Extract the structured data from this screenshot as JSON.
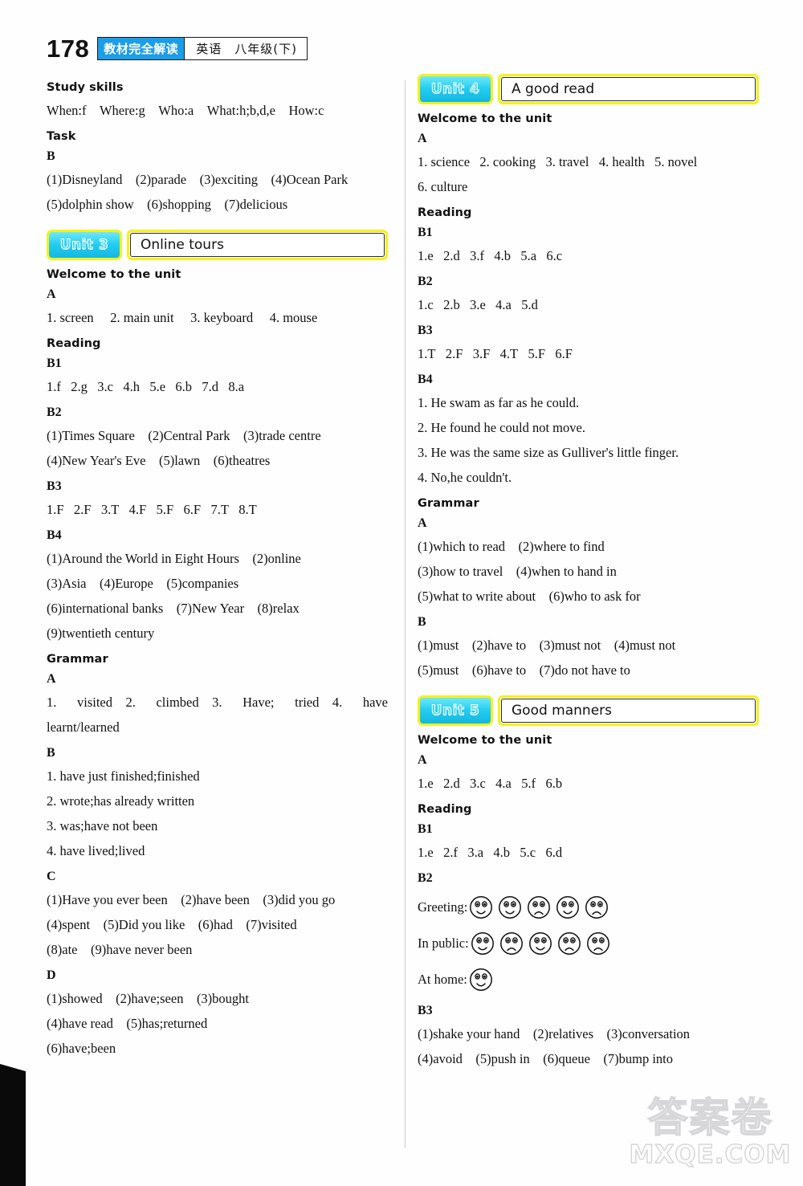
{
  "header": {
    "page_number": "178",
    "series_tag": "教材完全解读",
    "subject": "英语　八年级(下)"
  },
  "left_column": {
    "study_skills": {
      "heading": "Study skills",
      "answers": "When:f Where:g Who:a What:h;b,d,e How:c"
    },
    "task": {
      "heading": "Task",
      "sub": "B",
      "lines": [
        "(1)Disneyland (2)parade (3)exciting (4)Ocean Park",
        "(5)dolphin show (6)shopping (7)delicious"
      ]
    },
    "unit3": {
      "badge": "Unit 3",
      "title": "Online tours",
      "welcome_heading": "Welcome to the unit",
      "welcome_sub": "A",
      "welcome_answers": "1. screen  2. main unit  3. keyboard  4. mouse",
      "reading_heading": "Reading",
      "b1_label": "B1",
      "b1_answers": "1.f  2.g  3.c  4.h  5.e  6.b  7.d  8.a",
      "b2_label": "B2",
      "b2_lines": [
        "(1)Times Square (2)Central Park (3)trade centre",
        "(4)New Year's Eve (5)lawn (6)theatres"
      ],
      "b3_label": "B3",
      "b3_answers": "1.F  2.F  3.T  4.F  5.F  6.F  7.T  8.T",
      "b4_label": "B4",
      "b4_lines": [
        "(1)Around the World in Eight Hours (2)online",
        "(3)Asia (4)Europe (5)companies",
        "(6)international banks (7)New Year (8)relax",
        "(9)twentieth century"
      ],
      "grammar_heading": "Grammar",
      "grammar_a_label": "A",
      "grammar_a_line1": "1. visited 2. climbed 3. Have; tried 4. have",
      "grammar_a_line2": "learnt/learned",
      "grammar_b_label": "B",
      "grammar_b_lines": [
        "1. have just finished;finished",
        "2. wrote;has already written",
        "3. was;have not been",
        "4. have lived;lived"
      ],
      "grammar_c_label": "C",
      "grammar_c_lines": [
        "(1)Have you ever been (2)have been (3)did you go",
        "(4)spent (5)Did you like (6)had (7)visited",
        "(8)ate (9)have never been"
      ],
      "grammar_d_label": "D",
      "grammar_d_lines": [
        "(1)showed (2)have;seen (3)bought",
        "(4)have read (5)has;returned",
        "(6)have;been"
      ]
    }
  },
  "right_column": {
    "unit4": {
      "badge": "Unit 4",
      "title": "A good read",
      "welcome_heading": "Welcome to the unit",
      "welcome_sub": "A",
      "welcome_lines": [
        "1. science  2. cooking  3. travel  4. health  5. novel",
        "6. culture"
      ],
      "reading_heading": "Reading",
      "b1_label": "B1",
      "b1_answers": "1.e  2.d  3.f  4.b  5.a  6.c",
      "b2_label": "B2",
      "b2_answers": "1.c  2.b  3.e  4.a  5.d",
      "b3_label": "B3",
      "b3_answers": "1.T  2.F  3.F  4.T  5.F  6.F",
      "b4_label": "B4",
      "b4_lines": [
        "1. He swam as far as he could.",
        "2. He found he could not move.",
        "3. He was the same size as Gulliver's little finger.",
        "4. No,he couldn't."
      ],
      "grammar_heading": "Grammar",
      "grammar_a_label": "A",
      "grammar_a_lines": [
        "(1)which to read (2)where to find",
        "(3)how to travel (4)when to hand in",
        "(5)what to write about (6)who to ask for"
      ],
      "grammar_b_label": "B",
      "grammar_b_lines": [
        "(1)must (2)have to (3)must not (4)must not",
        "(5)must (6)have to (7)do not have to"
      ]
    },
    "unit5": {
      "badge": "Unit 5",
      "title": "Good manners",
      "welcome_heading": "Welcome to the unit",
      "welcome_sub": "A",
      "welcome_answers": "1.e  2.d  3.c  4.a  5.f  6.b",
      "reading_heading": "Reading",
      "b1_label": "B1",
      "b1_answers": "1.e  2.f  3.a  4.b  5.c  6.d",
      "b2_label": "B2",
      "b2_rows": [
        {
          "label": "Greeting:",
          "faces": [
            "happy",
            "happy",
            "sad",
            "happy",
            "sad"
          ]
        },
        {
          "label": "In public:",
          "faces": [
            "happy",
            "sad",
            "happy",
            "sad",
            "sad"
          ]
        },
        {
          "label": "At home:",
          "faces": [
            "happy"
          ]
        }
      ],
      "b3_label": "B3",
      "b3_lines": [
        "(1)shake your hand (2)relatives (3)conversation",
        "(4)avoid (5)push in (6)queue (7)bump into"
      ]
    }
  },
  "watermark": {
    "chinese": "答案卷",
    "site": "MXQE.COM"
  }
}
